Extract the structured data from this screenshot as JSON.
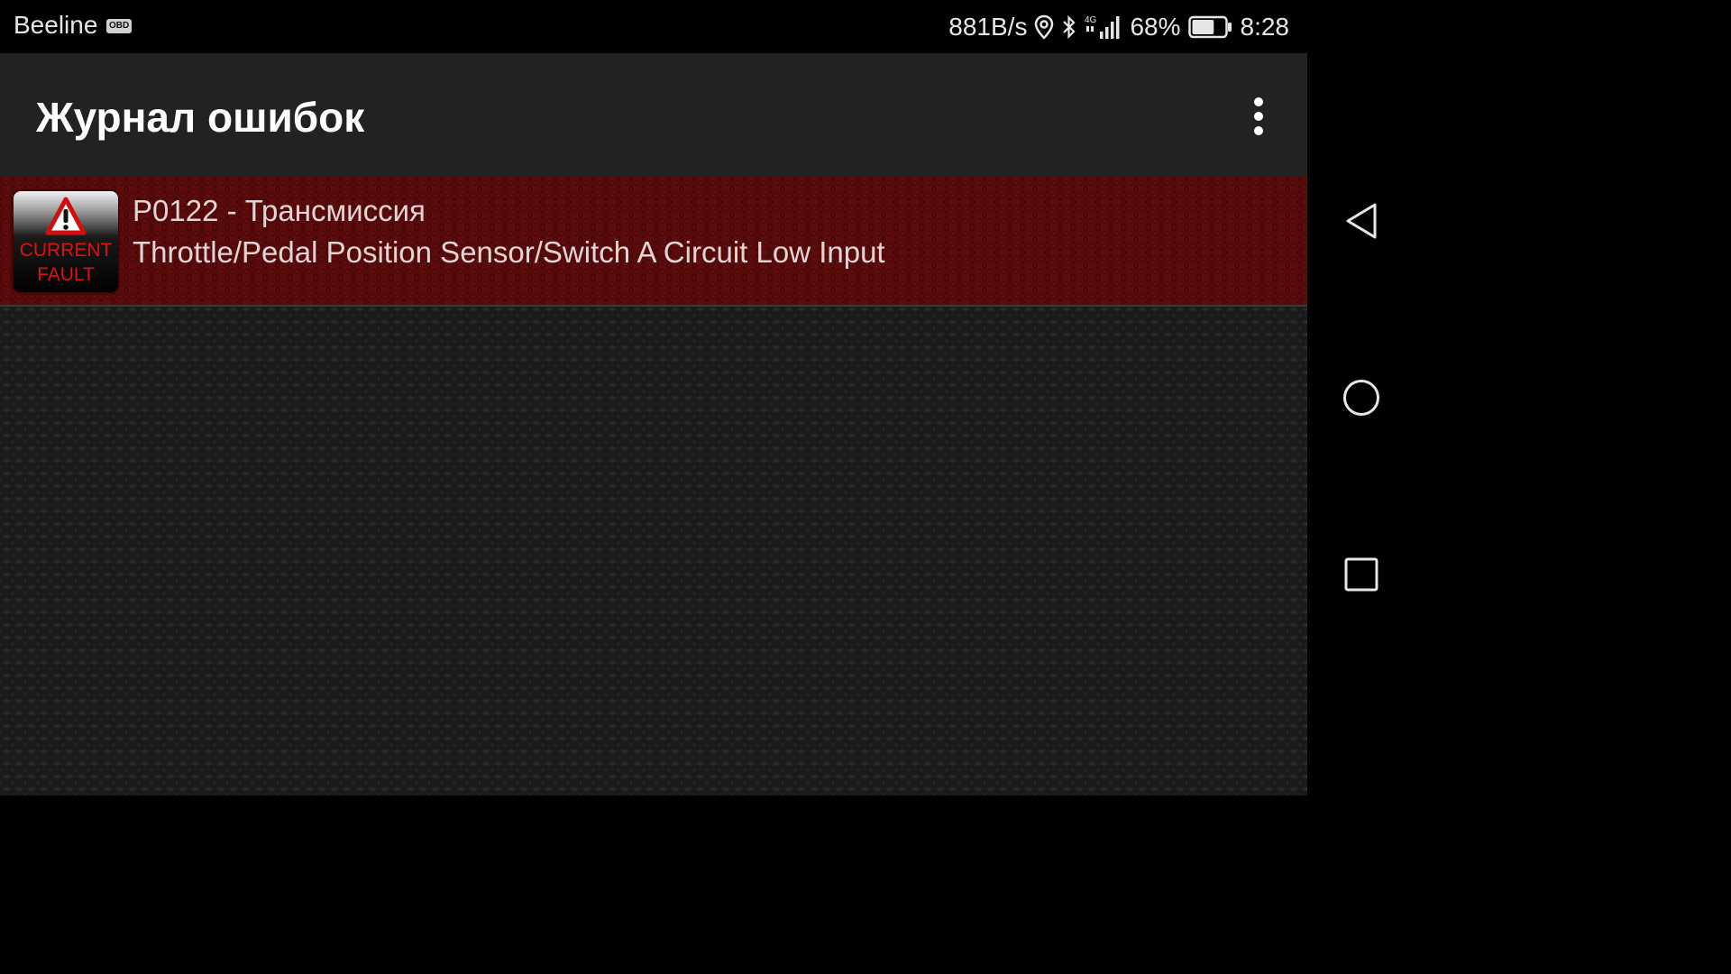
{
  "status_bar": {
    "carrier": "Beeline",
    "badge": "OBD",
    "net_speed": "881B/s",
    "network_type": "4G",
    "battery": "68%",
    "battery_level": 0.68,
    "time": "8:28",
    "icons": [
      "location-icon",
      "bluetooth-icon",
      "signal-icon",
      "battery-icon"
    ]
  },
  "app_bar": {
    "title": "Журнал ошибок",
    "menu_icon": "more-vert-icon"
  },
  "faults": [
    {
      "code": "P0122 - Трансмиссия",
      "description": "Throttle/Pedal Position Sensor/Switch A Circuit Low Input",
      "icon": {
        "name": "warning-icon",
        "label_line1": "CURRENT",
        "label_line2": "FAULT"
      }
    }
  ],
  "nav_bar": {
    "buttons": [
      "back-icon",
      "home-icon",
      "recents-icon"
    ]
  },
  "colors": {
    "fault_row": "#5a0b0b",
    "app_bar": "#222222",
    "fault_label": "#e01010"
  }
}
